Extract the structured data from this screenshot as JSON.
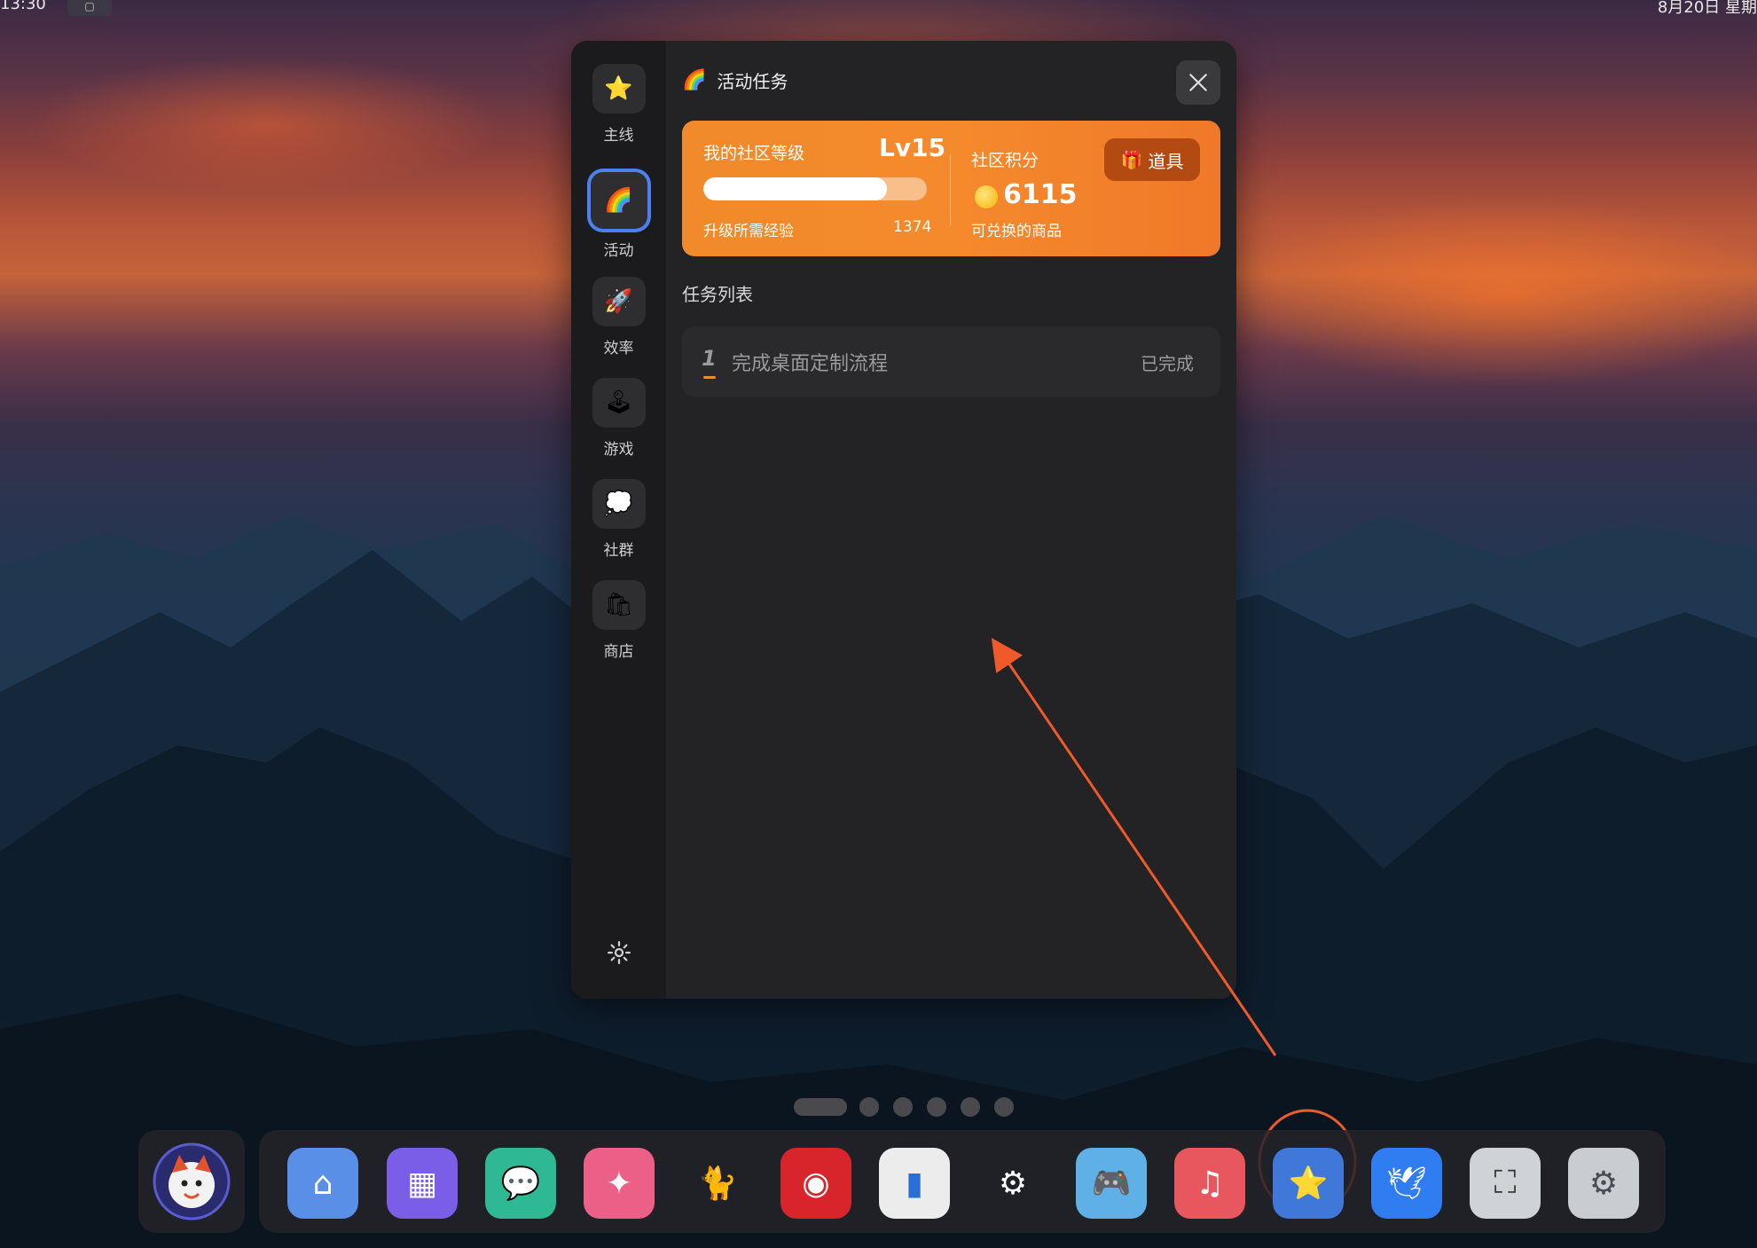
{
  "topbar": {
    "time": "13:30",
    "badge": "▢",
    "date": "8月20日 星期"
  },
  "sidebar": {
    "items": [
      {
        "label": "主线",
        "icon": "star-icon",
        "glyph": "⭐"
      },
      {
        "label": "活动",
        "icon": "rainbow-icon",
        "glyph": "🌈"
      },
      {
        "label": "效率",
        "icon": "rocket-icon",
        "glyph": "🚀"
      },
      {
        "label": "游戏",
        "icon": "joystick-icon",
        "glyph": "🕹"
      },
      {
        "label": "社群",
        "icon": "chat-bubble-icon",
        "glyph": "💭"
      },
      {
        "label": "商店",
        "icon": "shopping-bag-icon",
        "glyph": "🛍"
      }
    ],
    "settings_icon": "gear-icon"
  },
  "window": {
    "title_glyph": "🌈",
    "title": "活动任务",
    "close_icon": "close-icon"
  },
  "card": {
    "level_title": "我的社区等级",
    "level": "Lv15",
    "progress_fraction": 0.82,
    "exp_label": "升级所需经验",
    "exp_value": "1374",
    "points_title": "社区积分",
    "points": "6115",
    "redeem_label": "可兑换的商品",
    "props_label": "道具",
    "props_glyph": "🎁"
  },
  "tasks": {
    "section_title": "任务列表",
    "items": [
      {
        "num": "1",
        "name": "完成桌面定制流程",
        "status": "已完成"
      }
    ]
  },
  "pager": {
    "count": 6,
    "active": 0
  },
  "dock": {
    "items": [
      {
        "icon": "home-icon",
        "glyph": "⌂",
        "color": "#5a8fe8"
      },
      {
        "icon": "apps-grid-icon",
        "glyph": "▦",
        "color": "#7b5ee8"
      },
      {
        "icon": "chat-icon",
        "glyph": "💬",
        "color": "#2fb894"
      },
      {
        "icon": "creative-icon",
        "glyph": "✦",
        "color": "#ec5f86"
      },
      {
        "icon": "cat-icon",
        "glyph": "🐈",
        "color": "transparent"
      },
      {
        "icon": "game-center-icon",
        "glyph": "◉",
        "color": "#d8242b"
      },
      {
        "icon": "board-icon",
        "glyph": "▮",
        "color": "#ececec"
      },
      {
        "icon": "steam-icon",
        "glyph": "⚙",
        "color": "transparent"
      },
      {
        "icon": "gamepad-icon",
        "glyph": "🎮",
        "color": "#5fb0e6"
      },
      {
        "icon": "music-icon",
        "glyph": "♫",
        "color": "#e8575d"
      },
      {
        "icon": "star-badge-icon",
        "glyph": "⭐",
        "color": "#3f78d8"
      },
      {
        "icon": "bird-icon",
        "glyph": "🕊",
        "color": "#2f7df0"
      },
      {
        "icon": "screenshot-icon",
        "glyph": "⛶",
        "color": "#cfd2d6"
      },
      {
        "icon": "settings-icon",
        "glyph": "⚙",
        "color": "#c9ccd1"
      }
    ]
  },
  "accent": "#f08a2a",
  "annotation_color": "#f05a2a"
}
